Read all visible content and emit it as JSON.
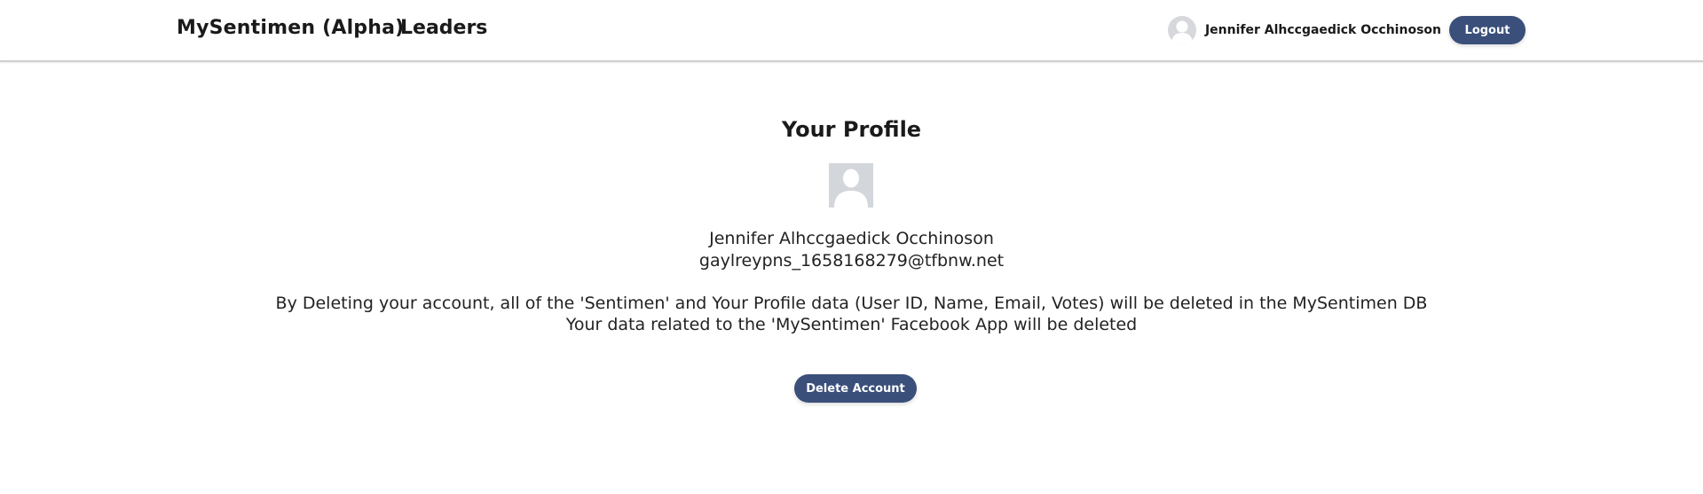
{
  "nav": {
    "brand": "MySentimen (Alpha)",
    "leaders_link": "Leaders",
    "user_name": "Jennifer Alhccgaedick Occhinoson",
    "logout_label": "Logout"
  },
  "profile": {
    "title": "Your Profile",
    "name": "Jennifer Alhccgaedick Occhinoson",
    "email": "gaylreypns_1658168279@tfbnw.net",
    "notice_line_1": "By Deleting your account, all of the 'Sentimen' and Your Profile data (User ID, Name, Email, Votes) will be deleted in the MySentimen DB",
    "notice_line_2": "Your data related to the 'MySentimen' Facebook App will be deleted",
    "delete_label": "Delete Account"
  },
  "colors": {
    "button_bg": "#3a4f7a",
    "avatar_bg": "#d3d6db"
  }
}
